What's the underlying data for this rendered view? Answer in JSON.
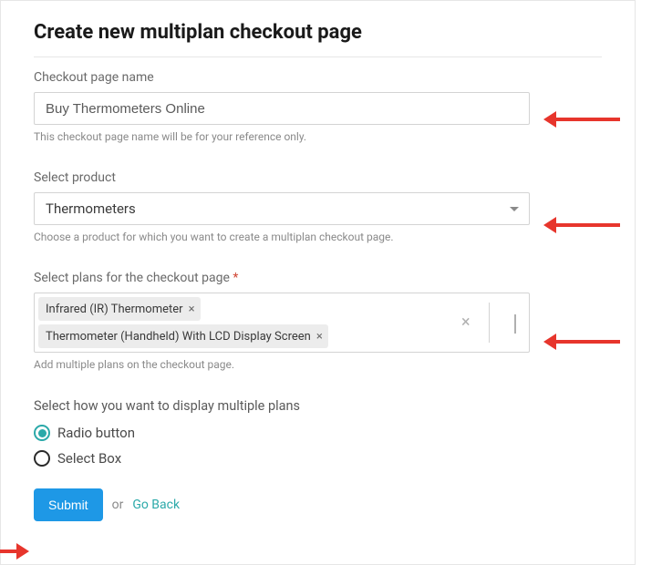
{
  "title": "Create new multiplan checkout page",
  "name_field": {
    "label": "Checkout page name",
    "value": "Buy Thermometers Online",
    "hint": "This checkout page name will be for your reference only."
  },
  "product_field": {
    "label": "Select product",
    "value": "Thermometers",
    "hint": "Choose a product for which you want to create a multiplan checkout page."
  },
  "plans_field": {
    "label": "Select plans for the checkout page",
    "required_marker": "*",
    "tags": [
      "Infrared (IR) Thermometer",
      "Thermometer (Handheld) With LCD Display Screen"
    ],
    "hint": "Add multiple plans on the checkout page."
  },
  "display_field": {
    "label": "Select how you want to display multiple plans",
    "options": [
      "Radio button",
      "Select Box"
    ],
    "selected": "Radio button"
  },
  "actions": {
    "submit": "Submit",
    "or": "or",
    "go_back": "Go Back"
  }
}
